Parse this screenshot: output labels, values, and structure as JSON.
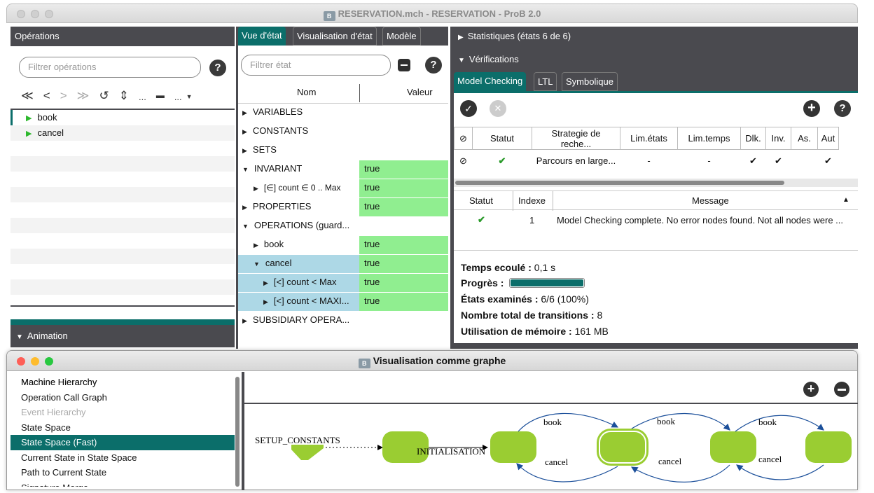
{
  "window": {
    "title": "RESERVATION.mch - RESERVATION - ProB 2.0",
    "icon": "prob-app-icon"
  },
  "operations": {
    "header": "Opérations",
    "filter_placeholder": "Filtrer opérations",
    "help": "?",
    "nav": [
      "≪",
      "<",
      ">",
      "≫",
      "↺",
      "⇕",
      "...",
      "▬",
      "..."
    ],
    "items": [
      {
        "label": "book"
      },
      {
        "label": "cancel"
      }
    ]
  },
  "animation": {
    "header": "Animation"
  },
  "state_view": {
    "tabs": [
      "Vue d'état",
      "Visualisation d'état",
      "Modèle"
    ],
    "filter_placeholder": "Filtrer état",
    "columns": {
      "name": "Nom",
      "value": "Valeur"
    },
    "rows": [
      {
        "name": "VARIABLES",
        "value": ""
      },
      {
        "name": "CONSTANTS",
        "value": ""
      },
      {
        "name": "SETS",
        "value": ""
      },
      {
        "name": "INVARIANT",
        "value": "true"
      },
      {
        "name": "[∈] count ∈ 0 .. Max",
        "value": "true"
      },
      {
        "name": "PROPERTIES",
        "value": "true"
      },
      {
        "name": "OPERATIONS (guard...",
        "value": ""
      },
      {
        "name": "book",
        "value": "true"
      },
      {
        "name": "cancel",
        "value": "true"
      },
      {
        "name": "[<] count < Max",
        "value": "true"
      },
      {
        "name": "[<] count < MAXI...",
        "value": "true"
      },
      {
        "name": "SUBSIDIARY OPERA...",
        "value": ""
      }
    ]
  },
  "right": {
    "stats_header": "Statistiques (états 6 de 6)",
    "verif_header": "Vérifications",
    "tabs": [
      "Model Checking",
      "LTL",
      "Symbolique"
    ],
    "mc_columns": [
      "Statut",
      "Strategie de reche...",
      "Lim.états",
      "Lim.temps",
      "Dlk.",
      "Inv.",
      "As.",
      "Aut"
    ],
    "mc_row": {
      "strategy": "Parcours en large...",
      "lim_states": "-",
      "lim_time": "-",
      "dlk": "✔",
      "inv": "✔",
      "as": "",
      "aut": "✔"
    },
    "msg_columns": [
      "Statut",
      "Indexe",
      "Message"
    ],
    "msg_row": {
      "index": "1",
      "message": "Model Checking complete. No error nodes found. Not all nodes were ..."
    },
    "stats": {
      "time_label": "Temps ecoulé :",
      "time_value": "0,1 s",
      "progress_label": "Progrès :",
      "progress": 1.0,
      "states_label": "États examinés :",
      "states_value": "6/6 (100%)",
      "transitions_label": "Nombre total de transitions :",
      "transitions_value": "8",
      "memory_label": "Utilisation de mémoire :",
      "memory_value": "161 MB"
    }
  },
  "graph_window": {
    "title": "Visualisation comme graphe",
    "list": [
      "Machine Hierarchy",
      "Operation Call Graph",
      "Event Hierarchy",
      "State Space",
      "State Space (Fast)",
      "Current State in State Space",
      "Path to Current State",
      "Signature Merge"
    ],
    "selected_index": 4,
    "disabled_index": 2,
    "labels": {
      "setup": "SETUP_CONSTANTS",
      "init": "INITIALISATION",
      "book": "book",
      "cancel": "cancel"
    }
  },
  "colors": {
    "teal": "#0b6e6a",
    "dark": "#4a4a4f",
    "node": "#9acd32",
    "green": "#90ee90",
    "blue": "#add8e6"
  }
}
